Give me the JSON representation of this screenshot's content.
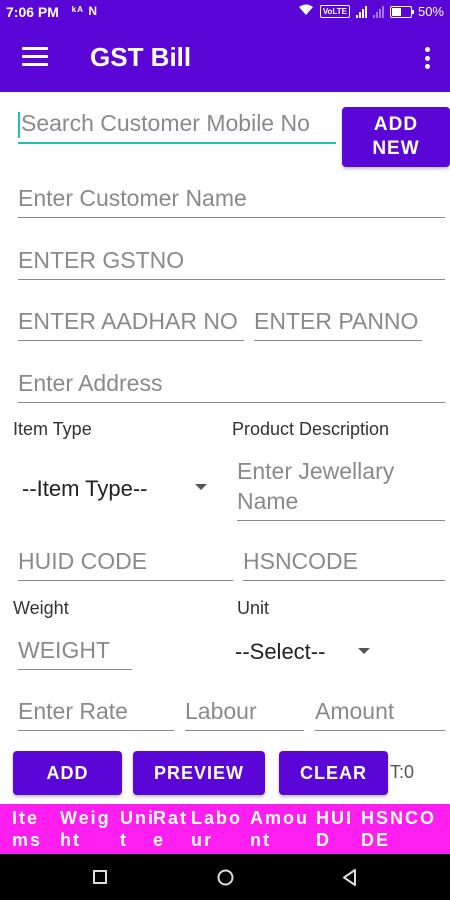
{
  "status": {
    "time": "7:06 PM",
    "left_icons": "ᵏᴬ N",
    "volte": "VoLTE",
    "battery": "50%"
  },
  "appbar": {
    "title": "GST Bill"
  },
  "form": {
    "search_placeholder": "Search Customer Mobile No",
    "add_new_label": "ADD NEW",
    "customer_name_placeholder": "Enter Customer Name",
    "gstno_placeholder": "ENTER GSTNO",
    "aadhar_placeholder": "ENTER AADHAR NO",
    "panno_placeholder": "ENTER PANNO",
    "address_placeholder": "Enter Address",
    "item_type_label": "Item Type",
    "product_desc_label": "Product Description",
    "item_type_selected": "--Item Type--",
    "jewellery_placeholder": "Enter Jewellary Name",
    "huid_placeholder": "HUID CODE",
    "hsncode_placeholder": "HSNCODE",
    "weight_label": "Weight",
    "unit_label": "Unit",
    "weight_placeholder": "WEIGHT",
    "unit_selected": "--Select--",
    "rate_placeholder": "Enter Rate",
    "labour_placeholder": "Labour",
    "amount_placeholder": "Amount"
  },
  "actions": {
    "add": "ADD",
    "preview": "PREVIEW",
    "clear": "CLEAR",
    "total": "T:0"
  },
  "table": {
    "headers": [
      "Items",
      "Weight",
      "Unit",
      "Rate",
      "Labour",
      "Amount",
      "HUID",
      "HSNCODE"
    ]
  },
  "colors": {
    "primary": "#5a06d6",
    "accent": "#18c4b0",
    "header_bg": "#ff1ef0"
  }
}
